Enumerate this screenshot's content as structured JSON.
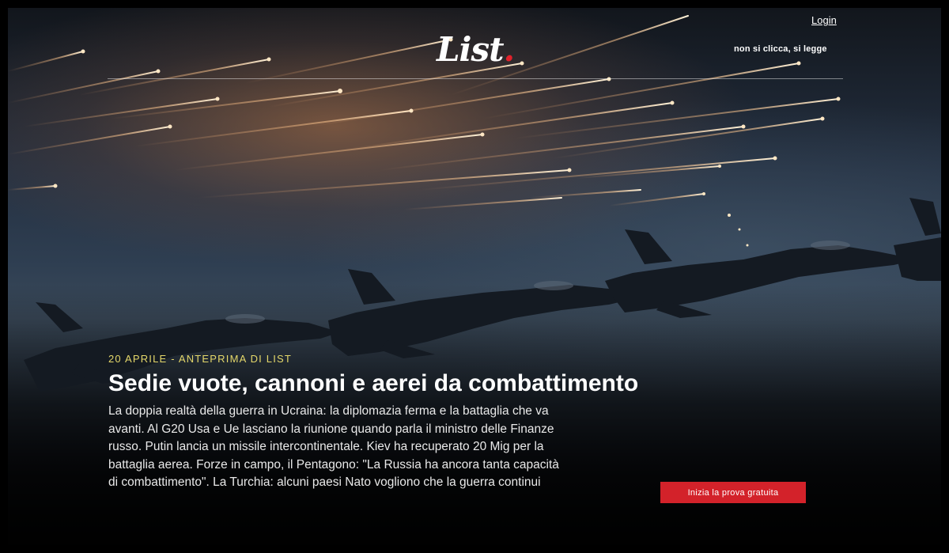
{
  "header": {
    "logo_text": "List",
    "logo_dot": ".",
    "login_label": "Login",
    "tagline": "non si clicca, si legge"
  },
  "article": {
    "kicker": "20 APRILE - ANTEPRIMA DI LIST",
    "headline": "Sedie vuote, cannoni e aerei da combattimento",
    "summary": "La doppia realtà della guerra in Ucraina: la diplomazia ferma e la battaglia che va avanti. Al G20 Usa e Ue lasciano la riunione quando parla il ministro delle Finanze russo. Putin lancia un missile intercontinentale. Kiev ha recuperato 20 Mig per la battaglia aerea. Forze in campo, il Pentagono: \"La Russia ha ancora tanta capacità di combattimento\". La Turchia: alcuni paesi Nato vogliono che la guerra continui"
  },
  "cta": {
    "label": "Inizia la prova gratuita"
  },
  "colors": {
    "brand_red": "#d3222a",
    "kicker_yellow": "#e4d76a",
    "text_white": "#ffffff"
  }
}
